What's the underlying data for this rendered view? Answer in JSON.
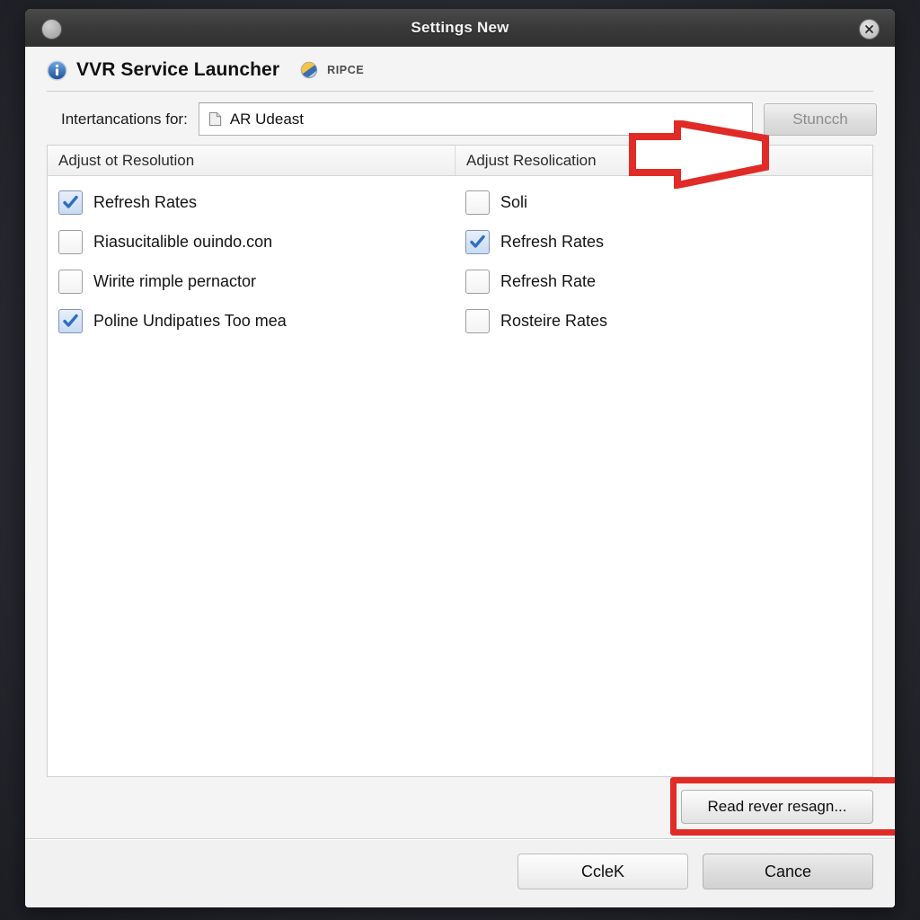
{
  "window": {
    "title": "Settings New",
    "close_icon": "close-icon",
    "left_dot_icon": "window-menu-dot-icon"
  },
  "header": {
    "info_icon": "info-icon",
    "app_title": "VVR Service Launcher",
    "globe_icon": "globe-icon",
    "brand": "RIPCE"
  },
  "filter": {
    "label": "Intertancations for:",
    "doc_icon": "document-icon",
    "selected": "AR Udeast",
    "launch_button": "Stuncch"
  },
  "list": {
    "columns": [
      {
        "header": "Adjust ot Resolution"
      },
      {
        "header": "Adjust Resolication"
      }
    ],
    "left_items": [
      {
        "label": "Refresh Rates",
        "checked": true
      },
      {
        "label": "Riasucitalible ouindo.con",
        "checked": false
      },
      {
        "label": "Wirite rimple pernactor",
        "checked": false
      },
      {
        "label": "Poline Undipatıes Too mea",
        "checked": true
      }
    ],
    "right_items": [
      {
        "label": "Soli",
        "checked": false
      },
      {
        "label": "Refresh Rates",
        "checked": true
      },
      {
        "label": "Refresh Rate",
        "checked": false
      },
      {
        "label": "Rosteire Rates",
        "checked": false
      }
    ]
  },
  "actions": {
    "browse_button": "Read rever resagn..."
  },
  "footer": {
    "ok_button": "CcleK",
    "cancel_button": "Cance"
  },
  "annotations": {
    "arrow_color": "#e02b27",
    "box_color": "#e02b27",
    "arrow_icon": "red-arrow-callout",
    "box_icon": "red-highlight-box"
  },
  "colors": {
    "titlebar": "#3b3b3b",
    "window_bg": "#f4f4f4",
    "panel_bg": "#ffffff",
    "accent_check": "#2f6fc0",
    "annotation_red": "#e02b27"
  }
}
